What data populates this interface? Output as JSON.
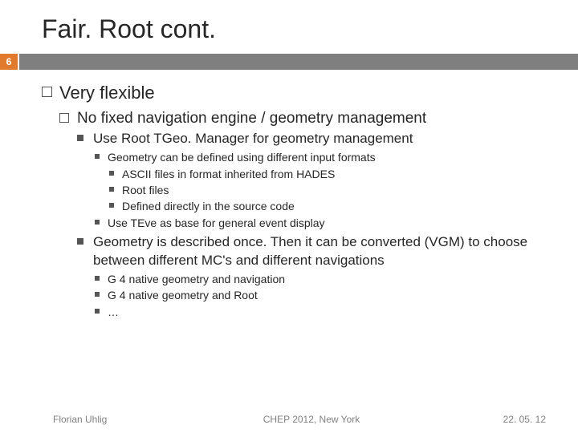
{
  "title": "Fair. Root cont.",
  "page_number": "6",
  "content": {
    "lvl1_item": "Very flexible",
    "lvl2_item": "No fixed navigation engine / geometry management",
    "lvl3_item1": "Use Root TGeo. Manager for geometry management",
    "lvl3_item1_sub1": "Geometry can be defined using different input formats",
    "lvl3_item1_sub1_a": "ASCII files in format inherited from HADES",
    "lvl3_item1_sub1_b": "Root files",
    "lvl3_item1_sub1_c": "Defined directly in the source code",
    "lvl3_item1_sub2": "Use TEve as base for general event display",
    "lvl3_item2": "Geometry is described once. Then it can be converted (VGM) to choose between different MC's and different navigations",
    "lvl3_item2_sub1": "G 4 native geometry and navigation",
    "lvl3_item2_sub2": "G 4 native geometry and Root",
    "lvl3_item2_sub3": "…"
  },
  "footer": {
    "author": "Florian Uhlig",
    "event": "CHEP 2012, New York",
    "date": "22. 05. 12"
  }
}
